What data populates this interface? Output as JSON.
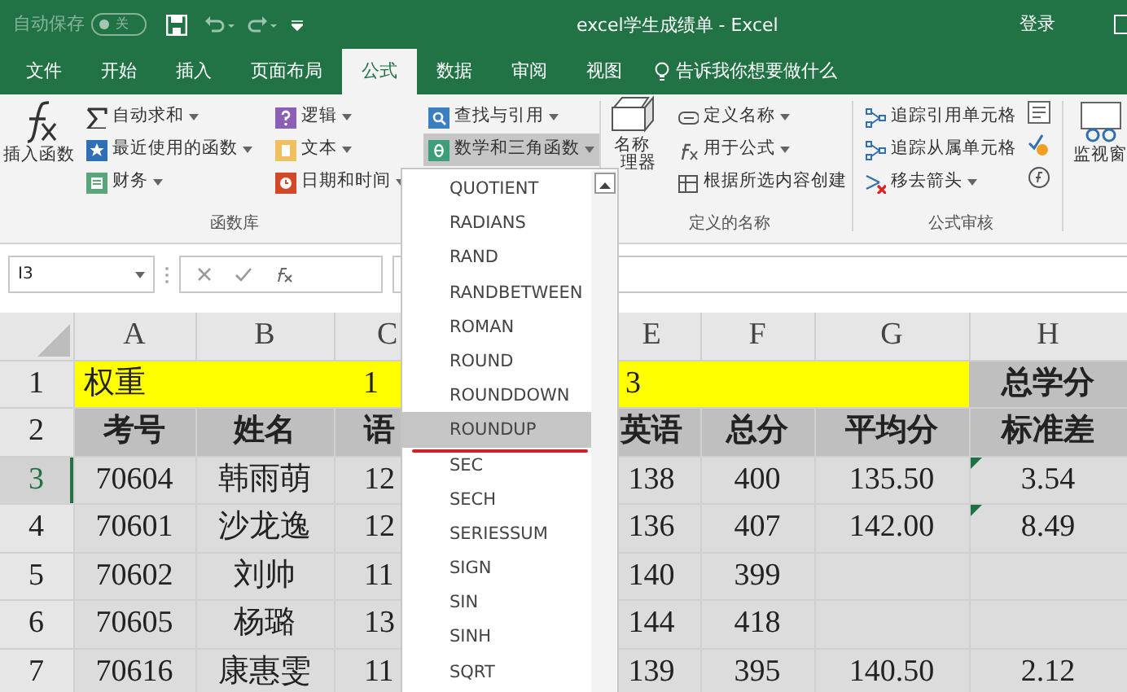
{
  "title_bar": {
    "autosave_label": "自动保存",
    "autosave_on": false,
    "autosave_state": "关",
    "title": "excel学生成绩单 - Excel",
    "sign_in": "登录"
  },
  "tabs": [
    {
      "label": "文件",
      "selected": false
    },
    {
      "label": "开始",
      "selected": false
    },
    {
      "label": "插入",
      "selected": false
    },
    {
      "label": "页面布局",
      "selected": false
    },
    {
      "label": "公式",
      "selected": true
    },
    {
      "label": "数据",
      "selected": false
    },
    {
      "label": "审阅",
      "selected": false
    },
    {
      "label": "视图",
      "selected": false
    }
  ],
  "tell_me": "告诉我你想要做什么",
  "ribbon": {
    "insert_function": "插入函数",
    "library": {
      "label": "函数库",
      "columns": [
        [
          {
            "label": "自动求和",
            "kind": "sum",
            "dropdown": true,
            "selected": false
          },
          {
            "label": "最近使用的函数",
            "kind": "star",
            "dropdown": true,
            "selected": false
          },
          {
            "label": "财务",
            "kind": "book",
            "dropdown": true,
            "selected": false
          }
        ],
        [
          {
            "label": "逻辑",
            "kind": "question",
            "dropdown": true,
            "selected": false
          },
          {
            "label": "文本",
            "kind": "text",
            "dropdown": true,
            "selected": false
          },
          {
            "label": "日期和时间",
            "kind": "clock",
            "dropdown": true,
            "selected": false
          }
        ],
        [
          {
            "label": "查找与引用",
            "kind": "search",
            "dropdown": true,
            "selected": false
          },
          {
            "label": "数学和三角函数",
            "kind": "theta",
            "dropdown": true,
            "selected": true
          }
        ]
      ]
    },
    "names": {
      "label": "定义的名称",
      "big_lines": [
        "名称",
        "理器"
      ],
      "items": [
        {
          "label": "定义名称",
          "kind": "tag",
          "dropdown": true
        },
        {
          "label": "用于公式",
          "kind": "fx",
          "dropdown": true
        },
        {
          "label": "根据所选内容创建",
          "kind": "grid",
          "dropdown": false
        }
      ]
    },
    "audit": {
      "label": "公式审核",
      "items": [
        {
          "label": "追踪引用单元格",
          "kind": "trace",
          "dropdown": false
        },
        {
          "label": "追踪从属单元格",
          "kind": "trace",
          "dropdown": false
        },
        {
          "label": "移去箭头",
          "kind": "remove",
          "dropdown": true
        }
      ],
      "watch": "监视窗"
    }
  },
  "formula_bar": {
    "name_box": "I3"
  },
  "sheet": {
    "columns": [
      "A",
      "B",
      "C",
      "",
      "E",
      "F",
      "G",
      "H"
    ],
    "rows": [
      {
        "number": "1",
        "kind": "weight",
        "selected": false,
        "cells": [
          "权重",
          "",
          "1",
          "",
          "3",
          "",
          "",
          "总学分"
        ]
      },
      {
        "number": "2",
        "kind": "header",
        "selected": false,
        "cells": [
          "考号",
          "姓名",
          "语",
          "",
          "英语",
          "总分",
          "平均分",
          "标准差"
        ]
      },
      {
        "number": "3",
        "kind": "data",
        "selected": true,
        "flag": true,
        "cells": [
          "70604",
          "韩雨萌",
          "12",
          "",
          "138",
          "400",
          "135.50",
          "3.54"
        ]
      },
      {
        "number": "4",
        "kind": "data",
        "selected": false,
        "flag": true,
        "cells": [
          "70601",
          "沙龙逸",
          "12",
          "",
          "136",
          "407",
          "142.00",
          "8.49"
        ]
      },
      {
        "number": "5",
        "kind": "data",
        "selected": false,
        "flag": false,
        "cells": [
          "70602",
          "刘帅",
          "11",
          "",
          "140",
          "399",
          "",
          ""
        ]
      },
      {
        "number": "6",
        "kind": "data",
        "selected": false,
        "flag": false,
        "cells": [
          "70605",
          "杨璐",
          "13",
          "",
          "144",
          "418",
          "",
          ""
        ]
      },
      {
        "number": "7",
        "kind": "data",
        "selected": false,
        "flag": false,
        "cells": [
          "70616",
          "康惠雯",
          "11",
          "",
          "139",
          "395",
          "140.50",
          "2.12"
        ]
      }
    ]
  },
  "dropdown": {
    "items": [
      {
        "label": "QUOTIENT",
        "selected": false
      },
      {
        "label": "RADIANS",
        "selected": false
      },
      {
        "label": "RAND",
        "selected": false
      },
      {
        "label": "RANDBETWEEN",
        "selected": false
      },
      {
        "label": "ROMAN",
        "selected": false
      },
      {
        "label": "ROUND",
        "selected": false
      },
      {
        "label": "ROUNDDOWN",
        "selected": false
      },
      {
        "label": "ROUNDUP",
        "selected": true
      },
      {
        "label": "SEC",
        "selected": false
      },
      {
        "label": "SECH",
        "selected": false
      },
      {
        "label": "SERIESSUM",
        "selected": false
      },
      {
        "label": "SIGN",
        "selected": false
      },
      {
        "label": "SIN",
        "selected": false
      },
      {
        "label": "SINH",
        "selected": false
      },
      {
        "label": "SQRT",
        "selected": false
      }
    ]
  }
}
